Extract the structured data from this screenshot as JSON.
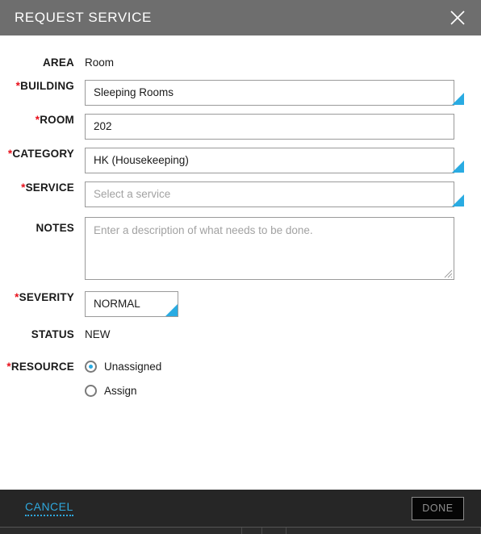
{
  "dialog": {
    "title": "REQUEST SERVICE",
    "close_icon": "close-icon"
  },
  "form": {
    "fields": [
      {
        "label": "AREA",
        "required": false,
        "type": "static",
        "value": "Room"
      },
      {
        "label": "BUILDING",
        "required": true,
        "type": "select",
        "value": "Sleeping Rooms"
      },
      {
        "label": "ROOM",
        "required": true,
        "type": "text",
        "value": "202"
      },
      {
        "label": "CATEGORY",
        "required": true,
        "type": "select",
        "value": "HK (Housekeeping)"
      },
      {
        "label": "SERVICE",
        "required": true,
        "type": "select",
        "value": "",
        "placeholder": "Select a service"
      },
      {
        "label": "NOTES",
        "required": false,
        "type": "textarea",
        "value": "",
        "placeholder": "Enter a description of what needs to be done."
      },
      {
        "label": "SEVERITY",
        "required": true,
        "type": "select",
        "value": "NORMAL"
      },
      {
        "label": "STATUS",
        "required": false,
        "type": "static",
        "value": "NEW"
      },
      {
        "label": "RESOURCE",
        "required": true,
        "type": "radio",
        "value": "Unassigned"
      }
    ],
    "resource_options": [
      {
        "label": "Unassigned",
        "selected": true
      },
      {
        "label": "Assign",
        "selected": false
      }
    ]
  },
  "footer": {
    "cancel_label": "CANCEL",
    "done_label": "DONE"
  },
  "colors": {
    "header_bg": "#6e6e6e",
    "footer_bg": "#262626",
    "accent_cyan": "#29abe2",
    "required_red": "#e8101b",
    "placeholder_grey": "#a2a2a2",
    "border_grey": "#9a9a9a"
  }
}
